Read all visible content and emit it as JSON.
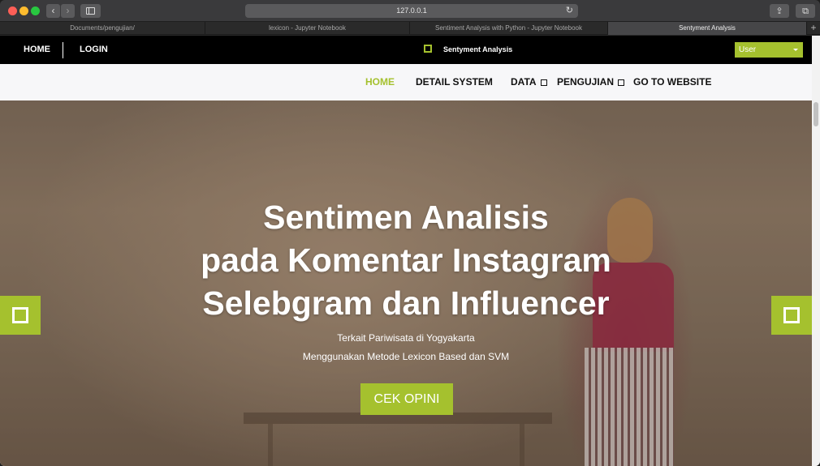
{
  "browser": {
    "url": "127.0.0.1",
    "tabs": [
      {
        "label": "Documents/pengujian/",
        "active": false
      },
      {
        "label": "lexicon - Jupyter Notebook",
        "active": false
      },
      {
        "label": "Sentiment Analysis with Python - Jupyter Notebook",
        "active": false
      },
      {
        "label": "Sentyment Analysis",
        "active": true
      }
    ],
    "icons": {
      "back": "chevron-left-icon",
      "forward": "chevron-right-icon",
      "reload": "reload-icon",
      "share": "share-icon",
      "tabs": "tabs-overview-icon",
      "add_tab": "plus-icon"
    }
  },
  "topnav": {
    "home": "HOME",
    "login": "LOGIN",
    "brand": "Sentyment Analysis",
    "user_select": "User"
  },
  "mainnav": {
    "home": "HOME",
    "detail": "DETAIL SYSTEM",
    "data": "DATA",
    "pengujian": "PENGUJIAN",
    "website": "GO TO WEBSITE"
  },
  "hero": {
    "title_line1": "Sentimen Analisis",
    "title_line2": "pada Komentar Instagram",
    "title_line3": "Selebgram dan Influencer",
    "subtitle1": "Terkait Pariwisata di Yogyakarta",
    "subtitle2": "Menggunakan Metode Lexicon Based dan SVM",
    "cta": "CEK OPINI"
  },
  "colors": {
    "accent": "#a5c12e",
    "topnav_bg": "#000000",
    "mainnav_bg": "#f7f7f9"
  }
}
